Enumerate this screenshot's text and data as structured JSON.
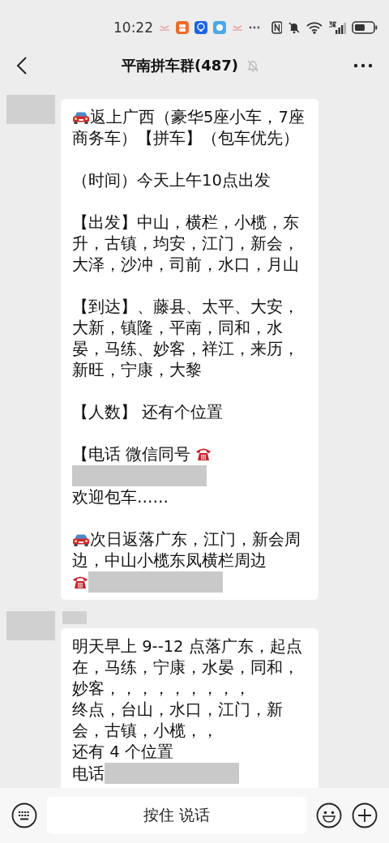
{
  "status_bar": {
    "time": "10:22"
  },
  "header": {
    "title": "平南拼车群(487)",
    "muted": true
  },
  "messages": [
    {
      "show_name": false,
      "paragraphs": [
        [
          {
            "kind": "car"
          },
          {
            "kind": "text",
            "text": "返上广西（豪华5座小车，7座"
          },
          {
            "kind": "break"
          },
          {
            "kind": "text",
            "text": "商务车）【拼车】（包车优先）"
          }
        ],
        [
          {
            "kind": "text",
            "text": "（时间）今天上午10点出发"
          }
        ],
        [
          {
            "kind": "text",
            "text": "【出发】中山，横栏，小榄，东升，古镇，均安，江门，新会，大泽，沙冲，司前，水口，月山"
          }
        ],
        [
          {
            "kind": "text",
            "text": "【到达】、藤县、太平、大安，大新，镇隆，平南，同和，水晏，马练、妙客，祥江，来历，新旺，宁康，大黎"
          }
        ],
        [
          {
            "kind": "text",
            "text": "【人数】 还有个位置"
          }
        ],
        [
          {
            "kind": "text",
            "text": "【电话 微信同号 "
          },
          {
            "kind": "phone"
          },
          {
            "kind": "break"
          },
          {
            "kind": "redacted"
          },
          {
            "kind": "break"
          },
          {
            "kind": "text",
            "text": "欢迎包车……"
          }
        ],
        [
          {
            "kind": "car"
          },
          {
            "kind": "text",
            "text": "次日返落广东，江门，新会周"
          },
          {
            "kind": "break"
          },
          {
            "kind": "text",
            "text": "边，中山小榄东凤横栏周边"
          },
          {
            "kind": "break"
          },
          {
            "kind": "phone"
          },
          {
            "kind": "redacted"
          }
        ]
      ]
    },
    {
      "show_name": true,
      "paragraphs": [
        [
          {
            "kind": "text",
            "text": "明天早上 9--12 点落广东，起点在，马练，宁康，水晏，同和，妙客，，，，，，，，，"
          },
          {
            "kind": "break"
          },
          {
            "kind": "text",
            "text": "终点，台山，水口，江门，新会，古镇，小榄，，"
          },
          {
            "kind": "break"
          },
          {
            "kind": "text",
            "text": "还有 4 个位置"
          },
          {
            "kind": "break"
          },
          {
            "kind": "text",
            "text": "电话"
          },
          {
            "kind": "redacted"
          }
        ]
      ]
    }
  ],
  "input_bar": {
    "hold_to_talk": "按住 说话"
  }
}
